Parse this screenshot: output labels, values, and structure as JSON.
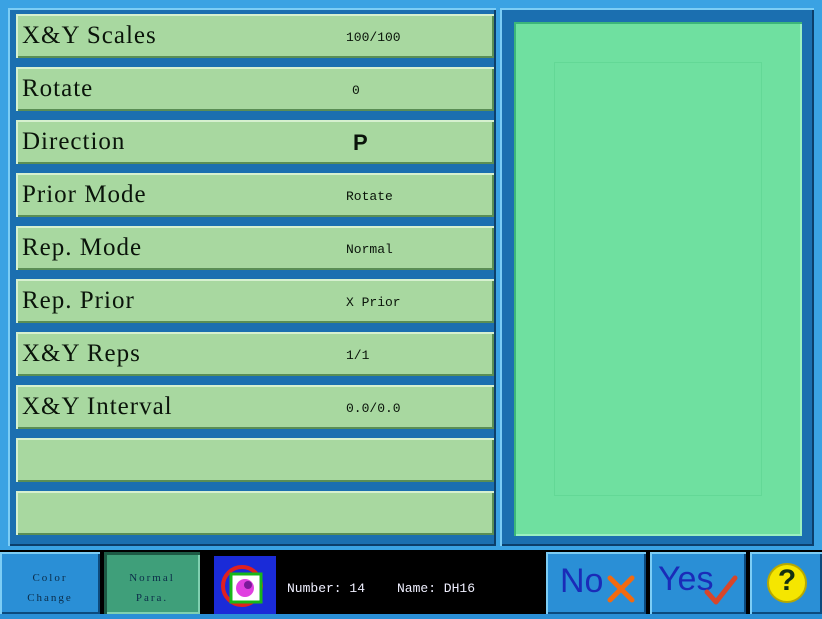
{
  "parameters": [
    {
      "label": "X&Y Scales",
      "value": "100/100"
    },
    {
      "label": "Rotate",
      "value": "0"
    },
    {
      "label": "Direction",
      "value": "P"
    },
    {
      "label": "Prior Mode",
      "value": "Rotate"
    },
    {
      "label": "Rep. Mode",
      "value": "Normal"
    },
    {
      "label": "Rep. Prior",
      "value": "X Prior"
    },
    {
      "label": "X&Y Reps",
      "value": "1/1"
    },
    {
      "label": "X&Y Interval",
      "value": "0.0/0.0"
    },
    {
      "label": "",
      "value": ""
    },
    {
      "label": "",
      "value": ""
    }
  ],
  "toolbar": {
    "color_change": {
      "line1": "Color",
      "line2": "Change"
    },
    "normal_para": {
      "line1": "Normal",
      "line2": "Para."
    },
    "number_label": "Number: 14",
    "name_label": "Name:  DH16",
    "no_label": "No",
    "yes_label": "Yes",
    "help_label": "?"
  },
  "colors": {
    "row_bg": "#a8d8a0",
    "preview_bg": "#6fe0a0",
    "frame_blue": "#3aa2e3",
    "help_yellow": "#f5e600"
  }
}
